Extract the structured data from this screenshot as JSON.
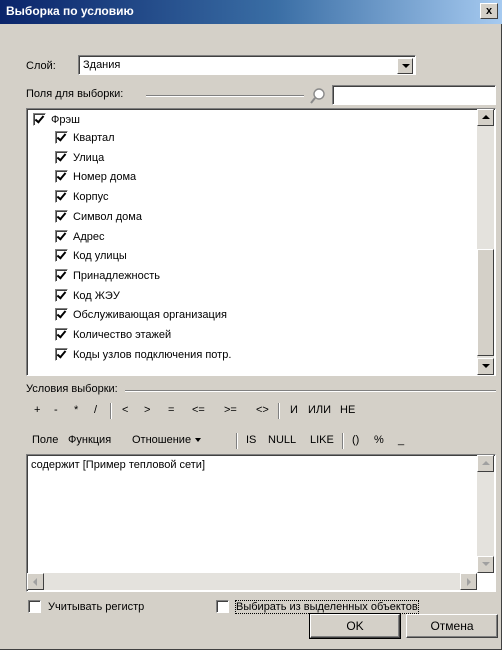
{
  "window": {
    "title": "Выборка по условию",
    "close_glyph": "x"
  },
  "layer": {
    "label": "Слой:",
    "value": "Здания"
  },
  "fields": {
    "label": "Поля для выборки:",
    "search_value": "",
    "root": {
      "label": "Фрэш",
      "checked": true
    },
    "items": [
      {
        "label": "Квартал",
        "checked": true
      },
      {
        "label": "Улица",
        "checked": true
      },
      {
        "label": "Номер дома",
        "checked": true
      },
      {
        "label": "Корпус",
        "checked": true
      },
      {
        "label": "Символ дома",
        "checked": true
      },
      {
        "label": "Адрес",
        "checked": true
      },
      {
        "label": "Код улицы",
        "checked": true
      },
      {
        "label": "Принадлежность",
        "checked": true
      },
      {
        "label": "Код ЖЭУ",
        "checked": true
      },
      {
        "label": "Обслуживающая организация",
        "checked": true
      },
      {
        "label": "Количество этажей",
        "checked": true
      },
      {
        "label": "Коды узлов подключения потр.",
        "checked": true
      }
    ]
  },
  "conditions": {
    "label": "Условия выборки:",
    "operators_row1": [
      "+",
      "-",
      "*",
      "/",
      "<",
      ">",
      "=",
      "<=",
      ">=",
      "<>",
      "И",
      "ИЛИ",
      "НЕ"
    ],
    "operators_row2": [
      "Поле",
      "Функция",
      "Отношение",
      "IS",
      "NULL",
      "LIKE",
      "()",
      "%",
      "_"
    ],
    "expression": "содержит [Пример тепловой сети]"
  },
  "options": {
    "case_sensitive_label": "Учитывать регистр",
    "case_sensitive_checked": false,
    "from_selected_label": "Выбирать из выделенных объектов",
    "from_selected_checked": false
  },
  "buttons": {
    "ok": "OK",
    "cancel": "Отмена"
  },
  "colors": {
    "dialog_bg": "#d4d0c8",
    "title_gradient_start": "#0a246a",
    "title_gradient_end": "#a6caf0"
  }
}
